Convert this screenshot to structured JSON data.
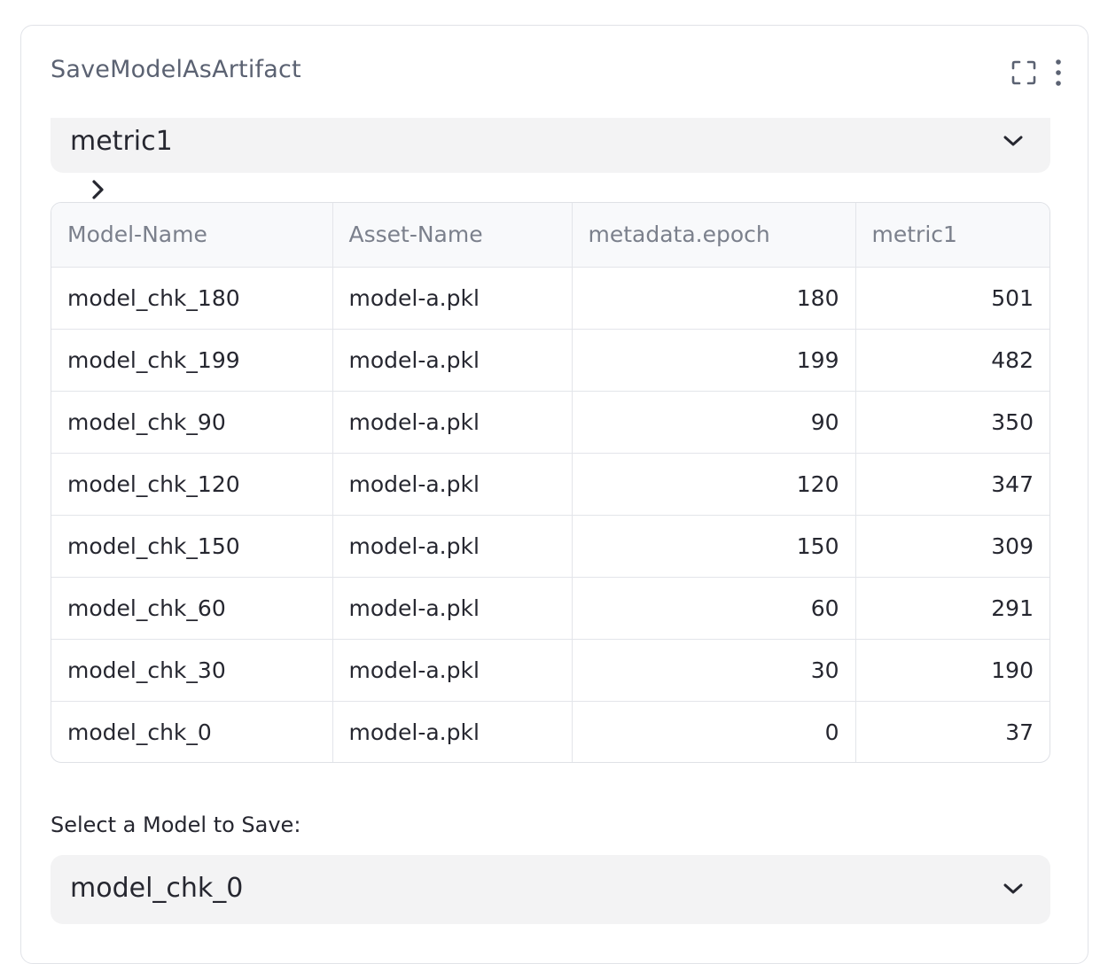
{
  "card": {
    "title": "SaveModelAsArtifact",
    "icons": {
      "expand": "fullscreen-icon",
      "more": "more-vertical-icon"
    }
  },
  "metric_select": {
    "value": "metric1",
    "icon": "chevron-down-icon"
  },
  "table_toggle": {
    "icon": "chevron-right-icon"
  },
  "table": {
    "columns": [
      "Model-Name",
      "Asset-Name",
      "metadata.epoch",
      "metric1"
    ],
    "rows": [
      [
        "model_chk_180",
        "model-a.pkl",
        "180",
        "501"
      ],
      [
        "model_chk_199",
        "model-a.pkl",
        "199",
        "482"
      ],
      [
        "model_chk_90",
        "model-a.pkl",
        "90",
        "350"
      ],
      [
        "model_chk_120",
        "model-a.pkl",
        "120",
        "347"
      ],
      [
        "model_chk_150",
        "model-a.pkl",
        "150",
        "309"
      ],
      [
        "model_chk_60",
        "model-a.pkl",
        "60",
        "291"
      ],
      [
        "model_chk_30",
        "model-a.pkl",
        "30",
        "190"
      ],
      [
        "model_chk_0",
        "model-a.pkl",
        "0",
        "37"
      ]
    ]
  },
  "model_select": {
    "label": "Select a Model to Save:",
    "value": "model_chk_0",
    "icon": "chevron-down-icon"
  },
  "colors": {
    "text": "#262730",
    "muted": "#7b808c",
    "select_bg": "#f3f3f4",
    "border": "#e3e5ea"
  }
}
